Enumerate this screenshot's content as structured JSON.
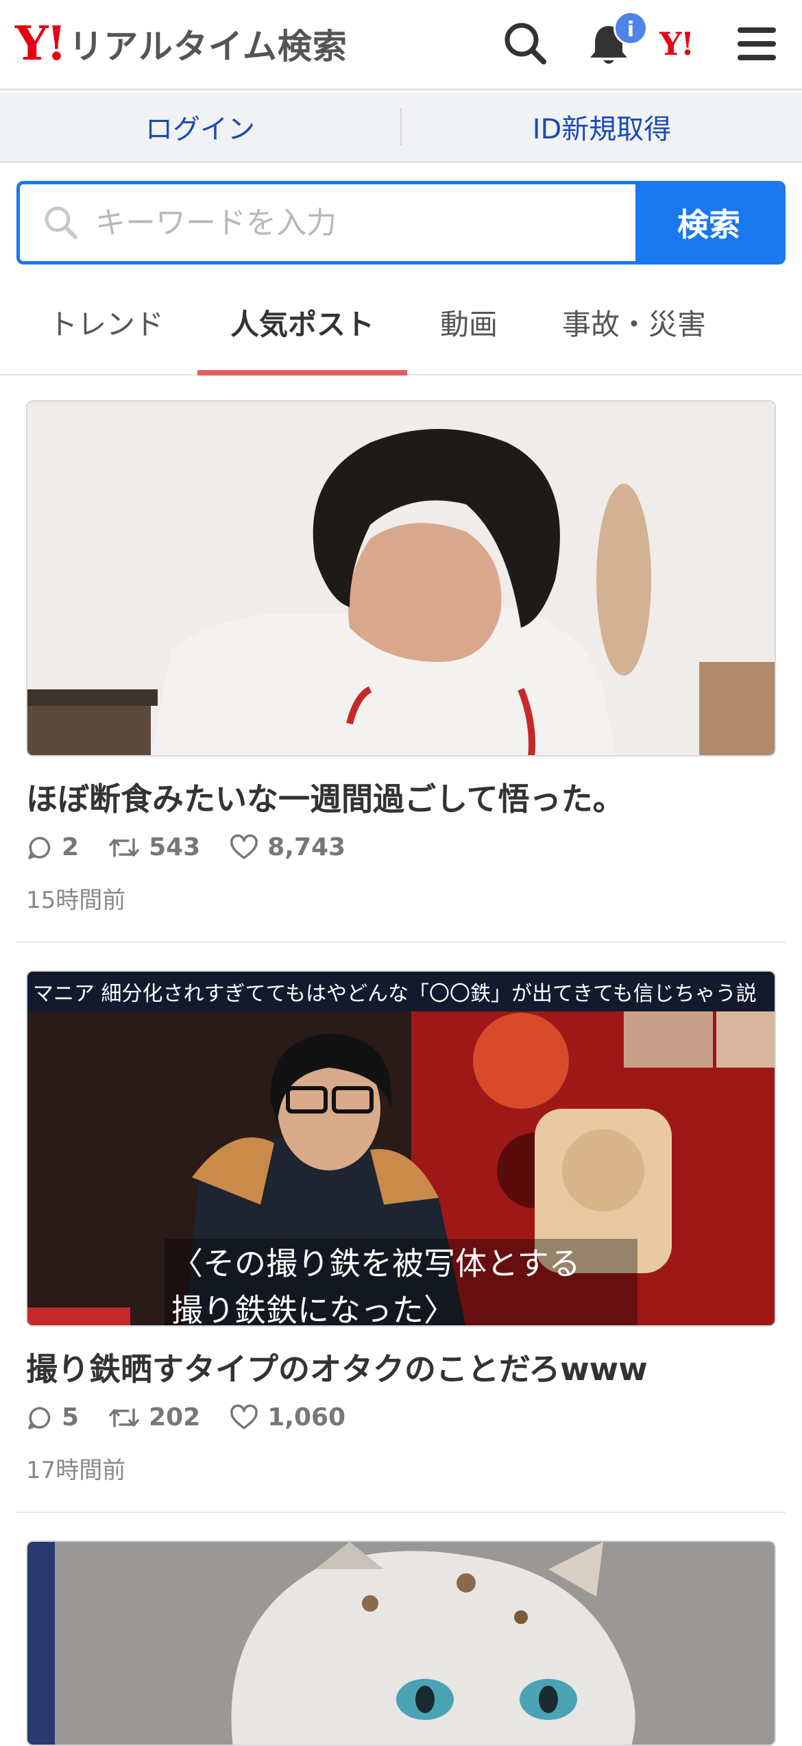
{
  "header": {
    "logo_mark": "Y!",
    "logo_text": "リアルタイム検索",
    "notification_badge": "i",
    "yjapan_mark": "Y!"
  },
  "account": {
    "login_label": "ログイン",
    "register_label": "ID新規取得"
  },
  "search": {
    "placeholder": "キーワードを入力",
    "button_label": "検索"
  },
  "tabs": [
    {
      "label": "トレンド",
      "active": false
    },
    {
      "label": "人気ポスト",
      "active": true
    },
    {
      "label": "動画",
      "active": false
    },
    {
      "label": "事故・災害",
      "active": false
    }
  ],
  "posts": [
    {
      "title": "ほぼ断食みたいな一週間過ごして悟った。",
      "replies": "2",
      "reposts": "543",
      "likes": "8,743",
      "time": "15時間前",
      "media": "photo-person"
    },
    {
      "title": "撮り鉄晒すタイプのオタクのことだろwww",
      "replies": "5",
      "reposts": "202",
      "likes": "1,060",
      "time": "17時間前",
      "media": "tv-screenshot",
      "caption_top": "マニア 細分化されすぎててもはやどんな「〇〇鉄」が出てきても信じちゃう説",
      "caption_line1": "〈その撮り鉄を被写体とする",
      "caption_line2": "撮り鉄鉄になった〉"
    },
    {
      "media": "photo-cat"
    }
  ],
  "colors": {
    "accent_blue": "#1a78ee",
    "brand_red": "#e60012",
    "tab_underline": "#e06060"
  }
}
